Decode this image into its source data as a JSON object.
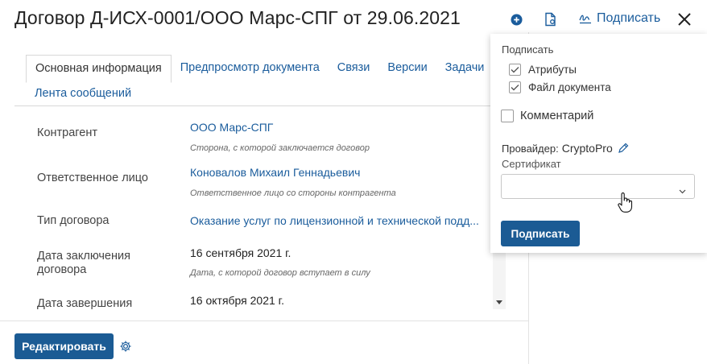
{
  "header": {
    "title": "Договор Д-ИСХ-0001/ООО Марс-СПГ от 29.06.2021",
    "add_icon": "plus-circle-icon",
    "doc_icon": "document-settings-icon",
    "sign_icon": "signature-icon",
    "sign_label": "Подписать",
    "close_icon": "close-icon"
  },
  "tabs": [
    {
      "label": "Основная информация",
      "active": true
    },
    {
      "label": "Предпросмотр документа"
    },
    {
      "label": "Связи"
    },
    {
      "label": "Версии"
    },
    {
      "label": "Задачи"
    },
    {
      "label": "Лента сообщений"
    }
  ],
  "fields": [
    {
      "label": "Контрагент",
      "value": "ООО Марс-СПГ",
      "hint": "Сторона, с которой заключается договор",
      "link": true
    },
    {
      "label": "Ответственное лицо",
      "value": "Коновалов Михаил Геннадьевич",
      "hint": "Ответственное лицо со стороны контрагента",
      "link": true
    },
    {
      "label": "Тип договора",
      "value": "Оказание услуг по лицензионной и технической подд...",
      "hint": "",
      "link": true
    },
    {
      "label": "Дата заключения договора",
      "value": "16 сентября 2021 г.",
      "hint": "Дата, с которой договор вступает в силу",
      "link": false
    },
    {
      "label": "Дата завершения",
      "value": "16 октября 2021 г.",
      "hint": "",
      "link": false
    }
  ],
  "footer": {
    "edit_label": "Редактировать",
    "settings_icon": "gear-icon"
  },
  "sign_popup": {
    "section_title": "Подписать",
    "options": [
      {
        "label": "Атрибуты",
        "checked": true
      },
      {
        "label": "Файл документа",
        "checked": true
      }
    ],
    "comment_label": "Комментарий",
    "comment_checked": false,
    "provider_label": "Провайдер:",
    "provider_value": "CryptoPro",
    "certificate_label": "Сертификат",
    "certificate_value": "",
    "submit_label": "Подписать"
  },
  "colors": {
    "accent": "#1b5b94",
    "link": "#1a5c9c"
  }
}
